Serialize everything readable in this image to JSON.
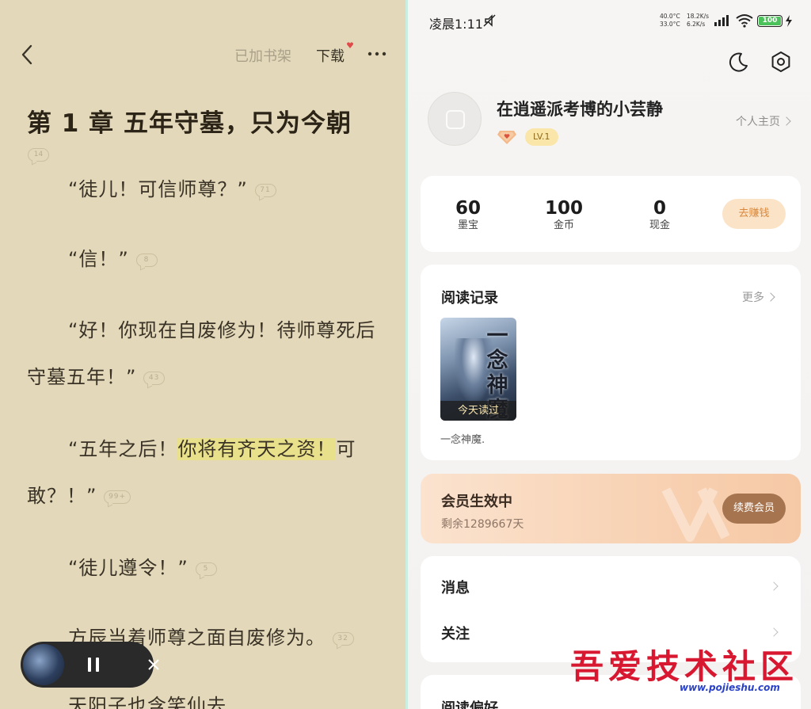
{
  "reader": {
    "shelf_label": "已加书架",
    "download_label": "下载",
    "chapter_title": "第 1 章 五年守墓，只为今朝",
    "title_comment_count": "14",
    "paragraphs": [
      {
        "text_before": "“徒儿！可信师尊？”",
        "highlight": "",
        "text_after": "",
        "comments": "71"
      },
      {
        "text_before": "“信！”",
        "highlight": "",
        "text_after": "",
        "comments": "8"
      },
      {
        "text_before": "“好！你现在自废修为！待师尊死后守墓五年！”",
        "highlight": "",
        "text_after": "",
        "comments": "43"
      },
      {
        "text_before": "“五年之后！",
        "highlight": "你将有齐天之资！",
        "text_after": "可敢？！”",
        "comments": "99+"
      },
      {
        "text_before": "“徒儿遵令！”",
        "highlight": "",
        "text_after": "",
        "comments": "5"
      },
      {
        "text_before": "方辰当着师尊之面自废修为。",
        "highlight": "",
        "text_after": "",
        "comments": "32"
      },
      {
        "text_before": "天阳子也含笑仙去",
        "highlight": "",
        "text_after": "",
        "comments": ""
      }
    ]
  },
  "status_bar": {
    "time": "凌晨1:11",
    "temp1": "40.0°C",
    "temp2": "33.0°C",
    "speed1": "18.2K/s",
    "speed2": "6.2K/s",
    "battery": "100"
  },
  "profile": {
    "username": "在逍遥派考博的小芸静",
    "level": "LV.1",
    "homepage_label": "个人主页"
  },
  "stats": [
    {
      "value": "60",
      "label": "墨宝"
    },
    {
      "value": "100",
      "label": "金币"
    },
    {
      "value": "0",
      "label": "现金"
    }
  ],
  "earn_label": "去赚钱",
  "history": {
    "title": "阅读记录",
    "more_label": "更多",
    "book": {
      "cover_title": "一念神魔",
      "badge": "今天读过",
      "name": "一念神魔."
    }
  },
  "vip": {
    "title": "会员生效中",
    "remaining": "剩余1289667天",
    "renew_label": "续费会员"
  },
  "menu": [
    {
      "label": "消息"
    },
    {
      "label": "关注"
    }
  ],
  "preferences_label": "阅读偏好",
  "watermark": {
    "text": "吾爱技术社区",
    "url": "www.pojieshu.com"
  },
  "colors": {
    "reader_bg": "#e3d9ba",
    "highlight": "#e8e08a",
    "earn_bg": "#fbe3c7",
    "vip_button": "#a77450",
    "watermark_red": "#d81830"
  }
}
